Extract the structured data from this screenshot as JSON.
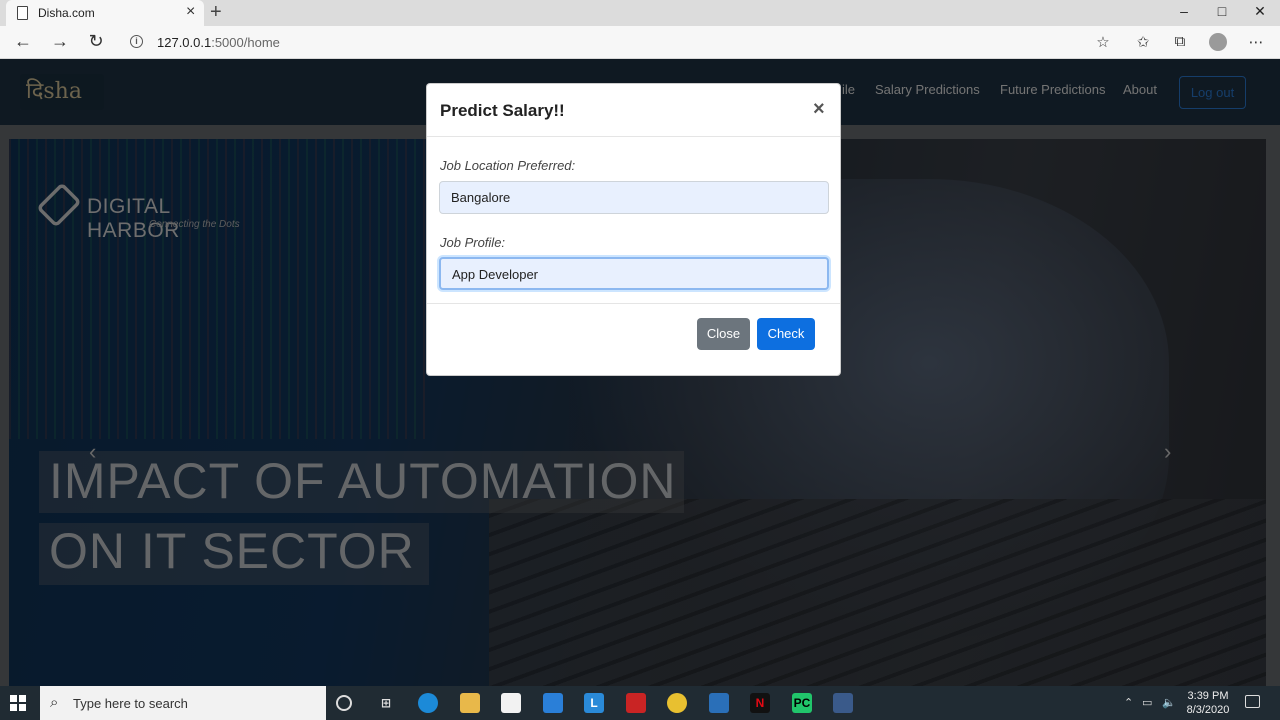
{
  "browser": {
    "tab_title": "Disha.com",
    "url_host": "127.0.0.1",
    "url_rest": ":5000/home"
  },
  "site": {
    "logo_text": "दिsha",
    "nav_partial": "ile",
    "nav_links": [
      "Salary Predictions",
      "Future Predictions",
      "About"
    ],
    "logout_label": "Log out"
  },
  "hero": {
    "brand": "DIGITAL HARBOR",
    "brand_tagline": "Connecting the Dots",
    "caption_line1": "IMPACT OF AUTOMATION",
    "caption_line2": "ON IT SECTOR"
  },
  "modal": {
    "title": "Predict Salary!!",
    "location_label": "Job Location Preferred:",
    "location_value": "Bangalore",
    "profile_label": "Job Profile:",
    "profile_value": "App Developer",
    "close_label": "Close",
    "check_label": "Check"
  },
  "taskbar": {
    "search_placeholder": "Type here to search",
    "time": "3:39 PM",
    "date": "8/3/2020"
  }
}
